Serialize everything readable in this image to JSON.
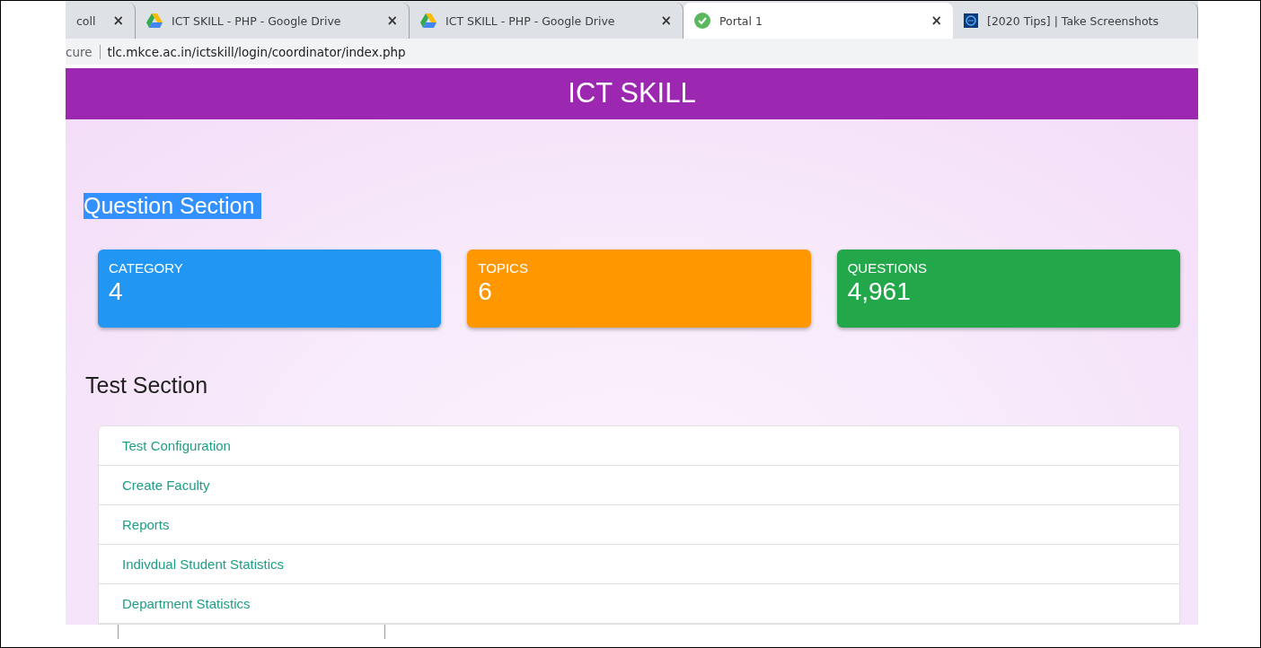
{
  "browser": {
    "tabs": [
      {
        "title": "coll",
        "kind": "plain",
        "close": "×",
        "selected": false
      },
      {
        "title": "ICT SKILL - PHP - Google Drive",
        "kind": "drive",
        "close": "×",
        "selected": false
      },
      {
        "title": "ICT SKILL - PHP - Google Drive",
        "kind": "drive",
        "close": "×",
        "selected": false
      },
      {
        "title": "Portal 1",
        "kind": "done",
        "close": "×",
        "selected": true
      },
      {
        "title": "[2020 Tips] | Take Screenshots",
        "kind": "site",
        "selected": false
      }
    ],
    "security": "cure",
    "url": "tlc.mkce.ac.in/ictskill/login/coordinator/index.php"
  },
  "header": {
    "title": "ICT SKILL"
  },
  "question_section": {
    "title": "Question Section",
    "highlighted": true,
    "cards": [
      {
        "label": "CATEGORY",
        "value": "4",
        "color": "#2196f3"
      },
      {
        "label": "TOPICS",
        "value": "6",
        "color": "#ff9800"
      },
      {
        "label": "QUESTIONS",
        "value": "4,961",
        "color": "#22a84a"
      }
    ]
  },
  "test_section": {
    "title": "Test Section",
    "items": [
      "Test Configuration",
      "Create Faculty",
      "Reports",
      "Indivdual Student Statistics",
      "Department Statistics"
    ]
  }
}
